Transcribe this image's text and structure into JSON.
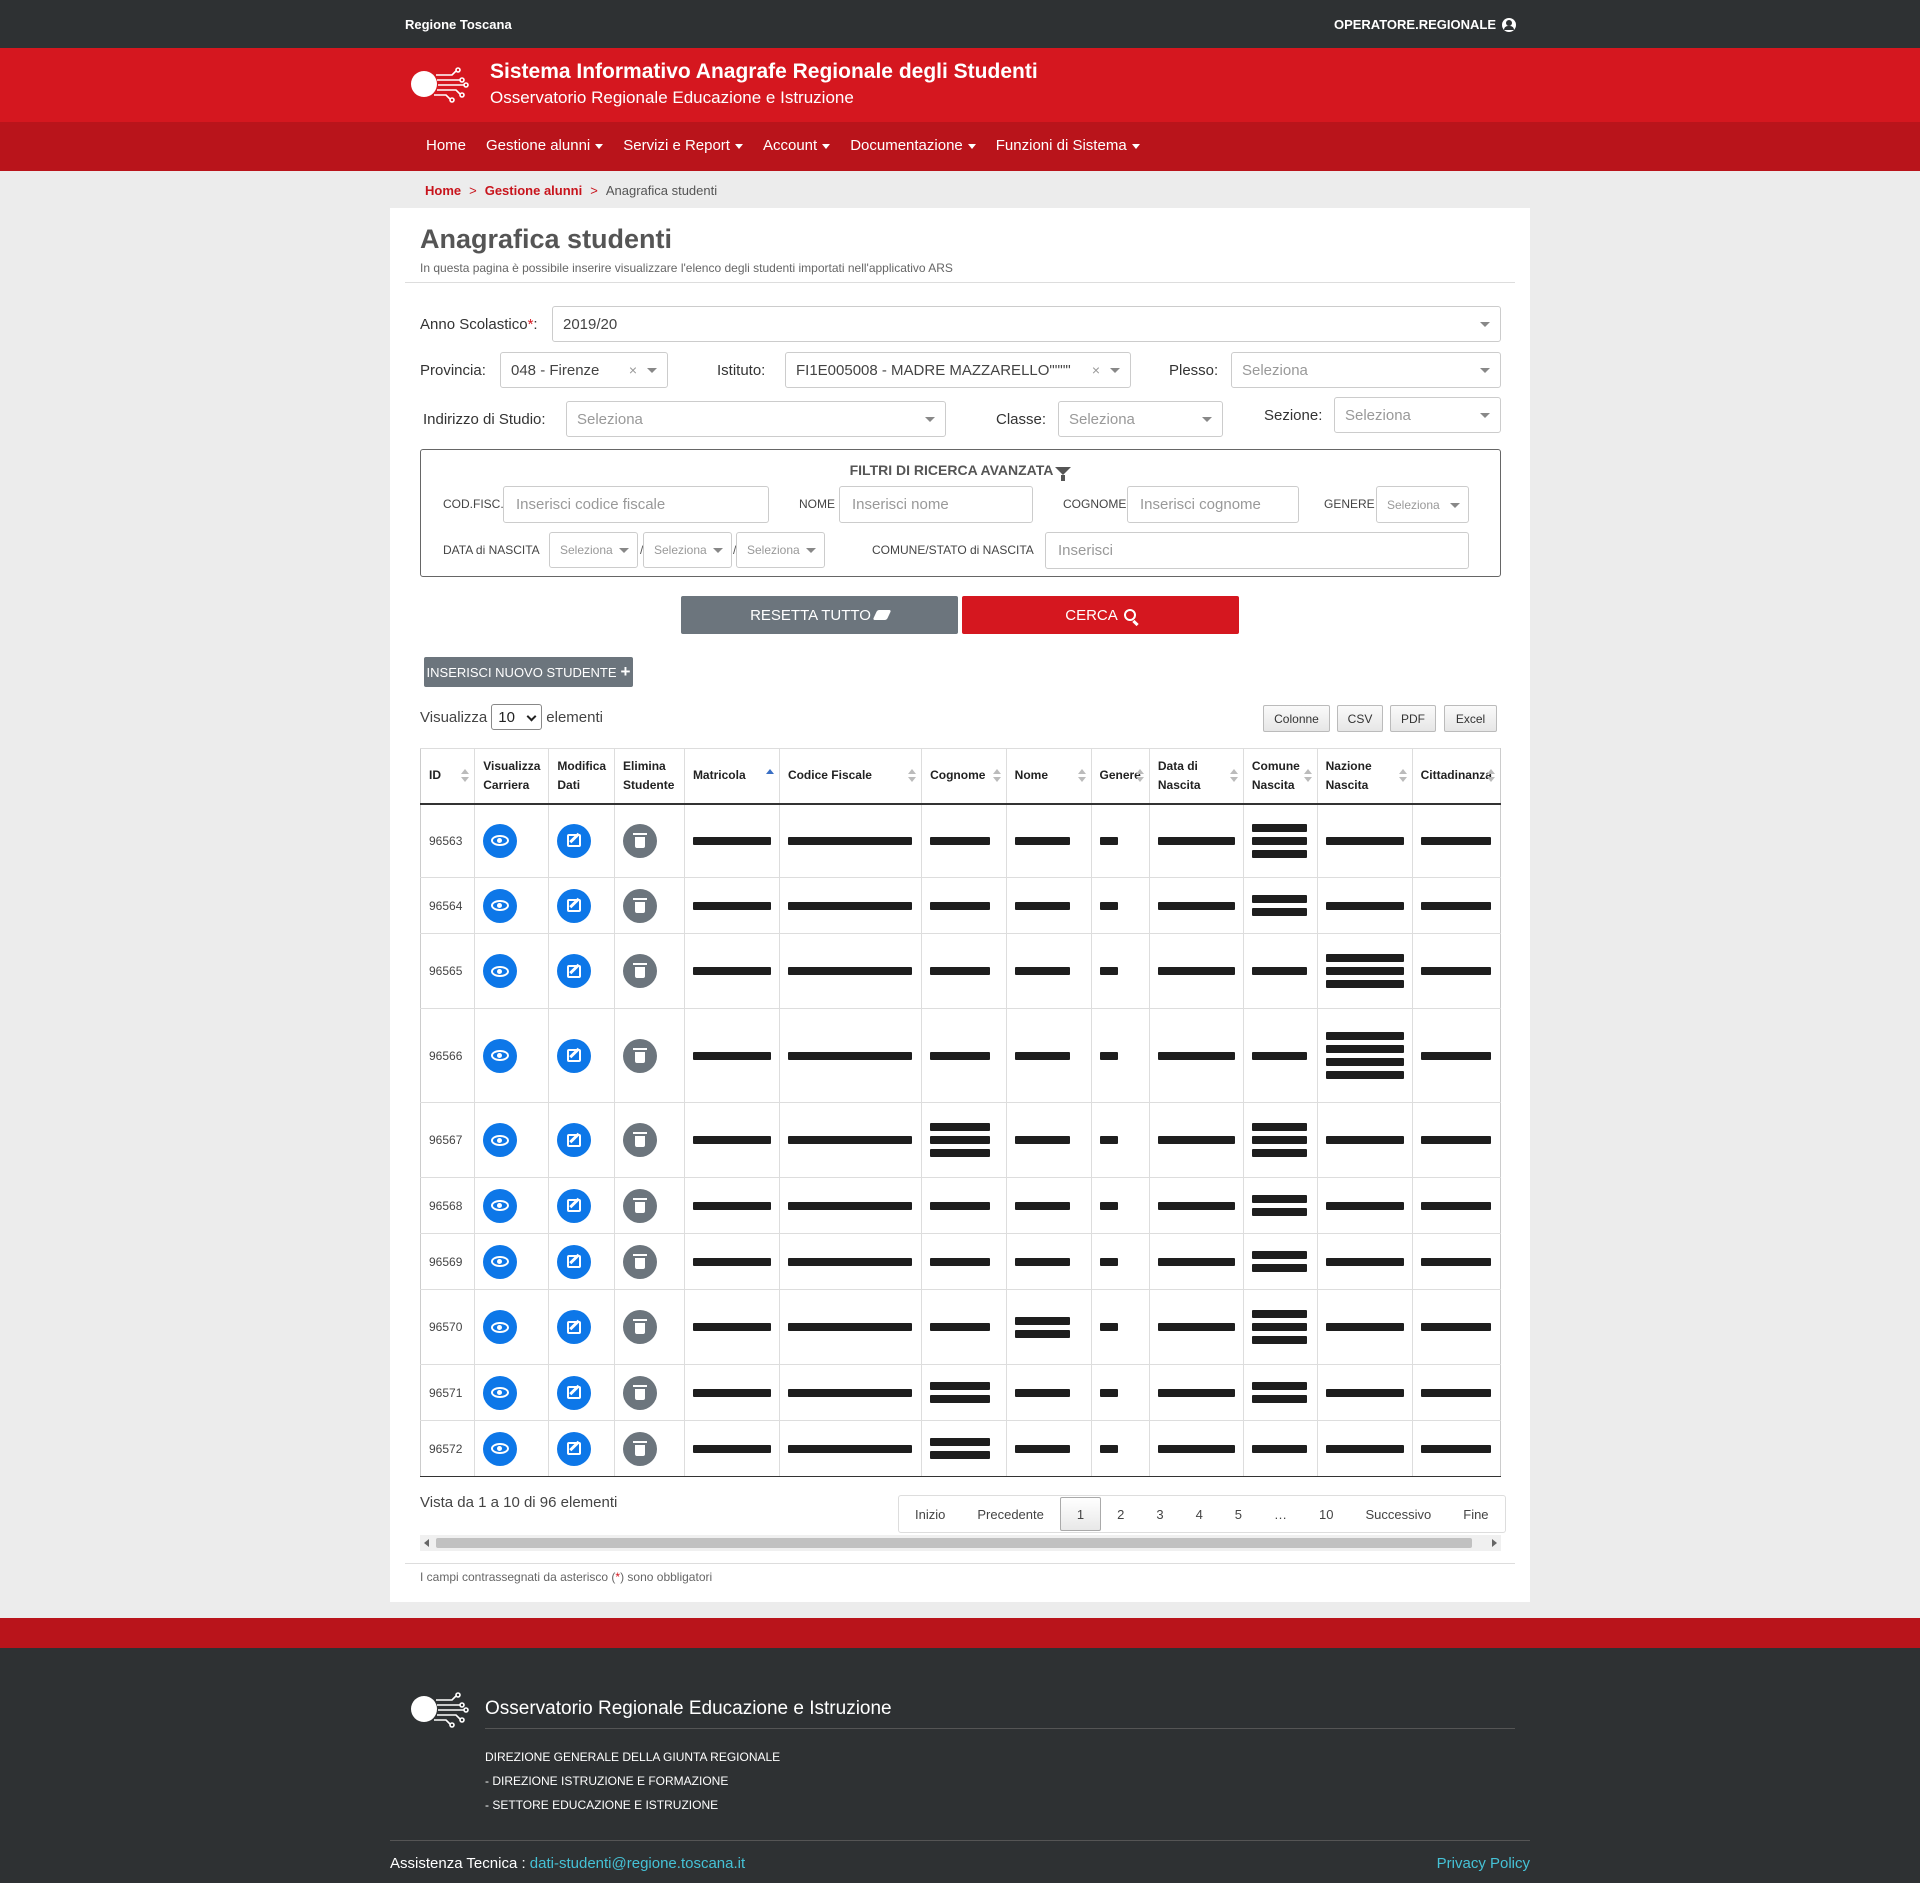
{
  "topbar": {
    "region": "Regione Toscana",
    "user": "OPERATORE.REGIONALE"
  },
  "header": {
    "title": "Sistema Informativo Anagrafe Regionale degli Studenti",
    "subtitle": "Osservatorio Regionale Educazione e Istruzione"
  },
  "nav": [
    "Home",
    "Gestione alunni",
    "Servizi e Report",
    "Account",
    "Documentazione",
    "Funzioni di Sistema"
  ],
  "breadcrumb": {
    "home": "Home",
    "section": "Gestione alunni",
    "current": "Anagrafica studenti",
    "sep": ">"
  },
  "page": {
    "title": "Anagrafica studenti",
    "description": "In questa pagina è possibile inserire visualizzare l'elenco degli studenti importati nell'applicativo ARS"
  },
  "form": {
    "anno_label": "Anno Scolastico",
    "anno_value": "2019/20",
    "provincia_label": "Provincia:",
    "provincia_value": "048 - Firenze",
    "istituto_label": "Istituto:",
    "istituto_value": "FI1E005008 - MADRE MAZZARELLO\"\"\"\"",
    "plesso_label": "Plesso:",
    "plesso_value": "Seleziona",
    "indirizzo_label": "Indirizzo di Studio:",
    "indirizzo_value": "Seleziona",
    "classe_label": "Classe:",
    "classe_value": "Seleziona",
    "sezione_label": "Sezione:",
    "sezione_value": "Seleziona"
  },
  "advanced": {
    "title": "FILTRI DI RICERCA AVANZATA",
    "codfisc_label": "COD.FISC.",
    "codfisc_placeholder": "Inserisci codice fiscale",
    "nome_label": "NOME",
    "nome_placeholder": "Inserisci nome",
    "cognome_label": "COGNOME",
    "cognome_placeholder": "Inserisci cognome",
    "genere_label": "GENERE",
    "genere_value": "Seleziona",
    "data_label": "DATA di NASCITA",
    "data_day": "Seleziona",
    "data_month": "Seleziona",
    "data_year": "Seleziona",
    "comune_label": "COMUNE/STATO di NASCITA",
    "comune_placeholder": "Inserisci"
  },
  "buttons": {
    "reset": "RESETTA TUTTO",
    "search": "CERCA",
    "new_student": "INSERISCI NUOVO STUDENTE"
  },
  "length": {
    "prefix": "Visualizza",
    "value": "10",
    "suffix": "elementi"
  },
  "export": [
    "Colonne",
    "CSV",
    "PDF",
    "Excel"
  ],
  "table": {
    "headers": [
      {
        "l1": "ID",
        "l2": ""
      },
      {
        "l1": "Visualizza",
        "l2": "Carriera"
      },
      {
        "l1": "Modifica",
        "l2": "Dati"
      },
      {
        "l1": "Elimina",
        "l2": "Studente"
      },
      {
        "l1": "Matricola",
        "l2": ""
      },
      {
        "l1": "Codice Fiscale",
        "l2": ""
      },
      {
        "l1": "Cognome",
        "l2": ""
      },
      {
        "l1": "Nome",
        "l2": ""
      },
      {
        "l1": "Genere",
        "l2": ""
      },
      {
        "l1": "Data di",
        "l2": "Nascita"
      },
      {
        "l1": "Comune",
        "l2": "Nascita"
      },
      {
        "l1": "Nazione",
        "l2": "Nascita"
      },
      {
        "l1": "Cittadinanza",
        "l2": ""
      }
    ],
    "ids": [
      "96563",
      "96564",
      "96565",
      "96566",
      "96567",
      "96568",
      "96569",
      "96570",
      "96571",
      "96572"
    ]
  },
  "pagination": {
    "info": "Vista da 1 a 10 di 96 elementi",
    "items": [
      "Inizio",
      "Precedente",
      "1",
      "2",
      "3",
      "4",
      "5",
      "…",
      "10",
      "Successivo",
      "Fine"
    ],
    "active": "1"
  },
  "note": {
    "prefix": "I campi contrassegnati da asterisco (",
    "star": "*",
    "suffix": ") sono obbligatori"
  },
  "footer": {
    "title": "Osservatorio Regionale Educazione e Istruzione",
    "dir1": "DIREZIONE GENERALE DELLA GIUNTA REGIONALE",
    "dir2": "- DIREZIONE ISTRUZIONE E FORMAZIONE",
    "dir3": "- SETTORE EDUCAZIONE E ISTRUZIONE",
    "assist_label": "Assistenza Tecnica :",
    "assist_email": "dati-studenti@regione.toscana.it",
    "privacy": "Privacy Policy"
  },
  "colors": {
    "brand_red": "#d5171f",
    "nav_red": "#b9141b",
    "dark": "#2e3133",
    "blue": "#0d77e8",
    "gray": "#6c757d",
    "link": "#45c2d6"
  }
}
